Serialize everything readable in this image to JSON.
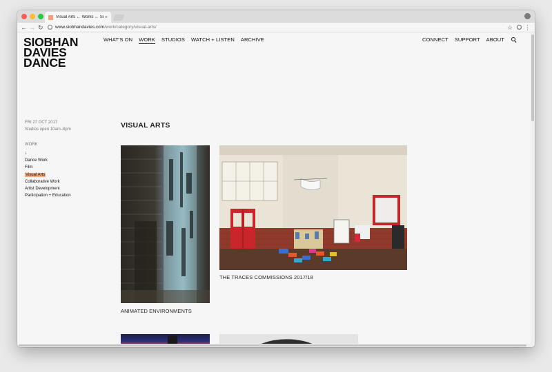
{
  "browser": {
    "tab_title": "Visual Arts ← Works ← Siobhan",
    "tab_close": "×",
    "url_domain": "www.siobhandavies.com",
    "url_path": "/work/category/visual-arts/",
    "nav_back": "←",
    "nav_forward": "→",
    "nav_reload": "↻",
    "star": "☆",
    "menu": "⋮"
  },
  "logo": {
    "line1": "SIOBHAN",
    "line2": "DAVIES",
    "line3": "DANCE"
  },
  "main_nav": [
    {
      "label": "WHAT'S ON"
    },
    {
      "label": "WORK"
    },
    {
      "label": "STUDIOS"
    },
    {
      "label": "WATCH + LISTEN"
    },
    {
      "label": "ARCHIVE"
    }
  ],
  "right_nav": [
    {
      "label": "CONNECT"
    },
    {
      "label": "SUPPORT"
    },
    {
      "label": "ABOUT"
    }
  ],
  "sidebar": {
    "date": "FRI 27 OCT 2017",
    "hours": "Studios open 10am–8pm",
    "section_title": "WORK",
    "arrow": "↓",
    "items": [
      {
        "label": "Dance Work"
      },
      {
        "label": "Film"
      },
      {
        "label": "Visual Arts"
      },
      {
        "label": "Collaborative Work"
      },
      {
        "label": "Artist Development"
      },
      {
        "label": "Participation + Education"
      }
    ]
  },
  "page": {
    "title": "VISUAL ARTS",
    "cards": [
      {
        "title": "ANIMATED ENVIRONMENTS"
      },
      {
        "title": "THE TRACES COMMISSIONS 2017/18"
      }
    ]
  },
  "colors": {
    "accent_highlight": "#f4a97e",
    "favicon": "#f0a37a",
    "text": "#111111"
  }
}
